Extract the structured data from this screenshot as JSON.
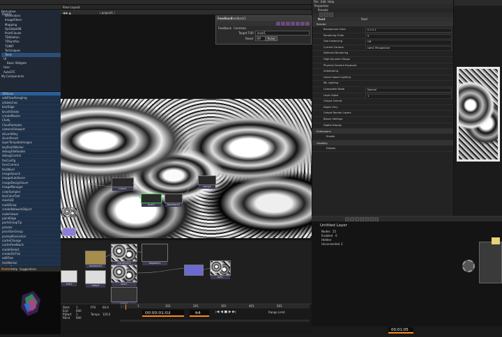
{
  "top_menu": {
    "items": [
      "File",
      "Edit",
      "Dialogs",
      "Help"
    ]
  },
  "tabs": {
    "items": [
      "TD",
      "Palette",
      "WiKi",
      "FORUM",
      "TUTORIALS",
      "PPs - AM",
      "PERFORM"
    ],
    "realtime_label": "Realtime",
    "status_msg": "14:31:43 Load Project: oct. 1834 - Loaded successfully",
    "pane_layout": "Pane Layout",
    "path_readout": "/ project1 /",
    "perform_title": "Perform"
  },
  "palette": {
    "header": "Palette",
    "tree": [
      "Derivative",
      "Generators",
      "ImageFilters",
      "Mapping",
      "OpGlobal08",
      "PointClouds",
      "TDAbleton",
      "TDSynthia",
      "TOMIT",
      "Techniques",
      "Tools",
      "UI",
      "Basic Widgets",
      "User",
      "AutoSTC",
      "My Components"
    ],
    "list": [
      "3Dfocus",
      "addFlowAlongImg",
      "allsketches",
      "blurEdge",
      "brushStroke",
      "createMaster",
      "Chefy",
      "CloudSamples",
      "cameraViewport",
      "driverWiley",
      "drumPreset",
      "layerTemplateImages",
      "keyPaintWorker",
      "debugFileReader",
      "debugControl",
      "fanConfig",
      "faceCamera",
      "findWord",
      "imageSearch",
      "imageAutoSaver",
      "imageDesignSaver",
      "imageManager",
      "colorSampler",
      "keyColorFast",
      "mesh3D",
      "multiDraw",
      "createNetworkObject",
      "nodeViewer",
      "paintEdge",
      "partsGroupTip",
      "presets",
      "prioritizeGroup",
      "promptExecution",
      "cacheChange",
      "cacheFeedback",
      "modelSelect",
      "createOnTick",
      "editTree",
      "textWorker",
      "selectBox",
      "aStandalone",
      "clusterSwap"
    ],
    "bottom_tabs": [
      "Palette",
      "Help",
      "Suggestions"
    ]
  },
  "viewer": {
    "feedback_title": "Feedback",
    "feedback_node": "feedback1",
    "subtabs": [
      "Feedback",
      "Common"
    ],
    "target_label": "Target TOP",
    "target_value": "level1",
    "reset_label": "Reset",
    "reset_value": "Off",
    "pulse_label": "Pulse"
  },
  "network": {
    "nodes": [
      "noise1",
      "level1",
      "feedback1",
      "comp1",
      "transform1",
      "displace1",
      "out1",
      "blur1",
      "movieout1",
      "circle1",
      "ramp1",
      "null1"
    ]
  },
  "timeline": {
    "labels": [
      "Start",
      "End",
      "RStart",
      "REnd"
    ],
    "values": [
      "1",
      "600",
      "1",
      "600"
    ],
    "fps_label": "FPS",
    "fps_value": "60.0",
    "tempo_label": "Tempo",
    "tempo_value": "120.0",
    "ticks": [
      "1",
      "101",
      "201",
      "301",
      "401",
      "501"
    ],
    "timecode": "00:00:01:03",
    "frame": "64",
    "range_label": "Range Limit"
  },
  "params": {
    "window_title": "Properties",
    "tab": "Presets",
    "op_name": "Root",
    "op_type": "Root",
    "section_header": "Render",
    "rows": [
      {
        "name": "Background Color",
        "value": "0 0 0 1"
      },
      {
        "name": "Rendering Order",
        "value": "0"
      },
      {
        "name": "Geo Instancing",
        "value": "Off"
      },
      {
        "name": "Current Camera",
        "value": "cam1 Perspective"
      },
      {
        "name": "Deferred Rendering",
        "value": ""
      },
      {
        "name": "High Dynamic Range",
        "value": ""
      },
      {
        "name": "Physical Camera Exposure",
        "value": ""
      },
      {
        "name": "Antialiasing",
        "value": ""
      },
      {
        "name": "Linear Space Lighting",
        "value": ""
      },
      {
        "name": "IBL Lighting",
        "value": ""
      },
      {
        "name": "Composite Mode",
        "value": "Normal"
      },
      {
        "name": "Layer Alpha",
        "value": "1"
      },
      {
        "name": "Output Format",
        "value": ""
      },
      {
        "name": "Depth Only",
        "value": ""
      },
      {
        "name": "Output Render Layers",
        "value": ""
      },
      {
        "name": "Bloom Settings",
        "value": ""
      },
      {
        "name": "Digital Display",
        "value": ""
      }
    ],
    "sections": [
      "Extensions",
      "Visibility"
    ],
    "extra_rows": [
      "Enable",
      "Display"
    ]
  },
  "graph": {
    "title": "Untitled Layer",
    "stats": [
      {
        "label": "Nodes",
        "value": "25"
      },
      {
        "label": "Enabled",
        "value": "0"
      },
      {
        "label": "Hidden",
        "value": ""
      },
      {
        "label": "Unconnected",
        "value": "2"
      }
    ],
    "timecode": "00:01:05"
  },
  "colors": {
    "accent": "#ff8c1a",
    "viewer_bg": "#141414",
    "select": "#2b5f9a"
  }
}
